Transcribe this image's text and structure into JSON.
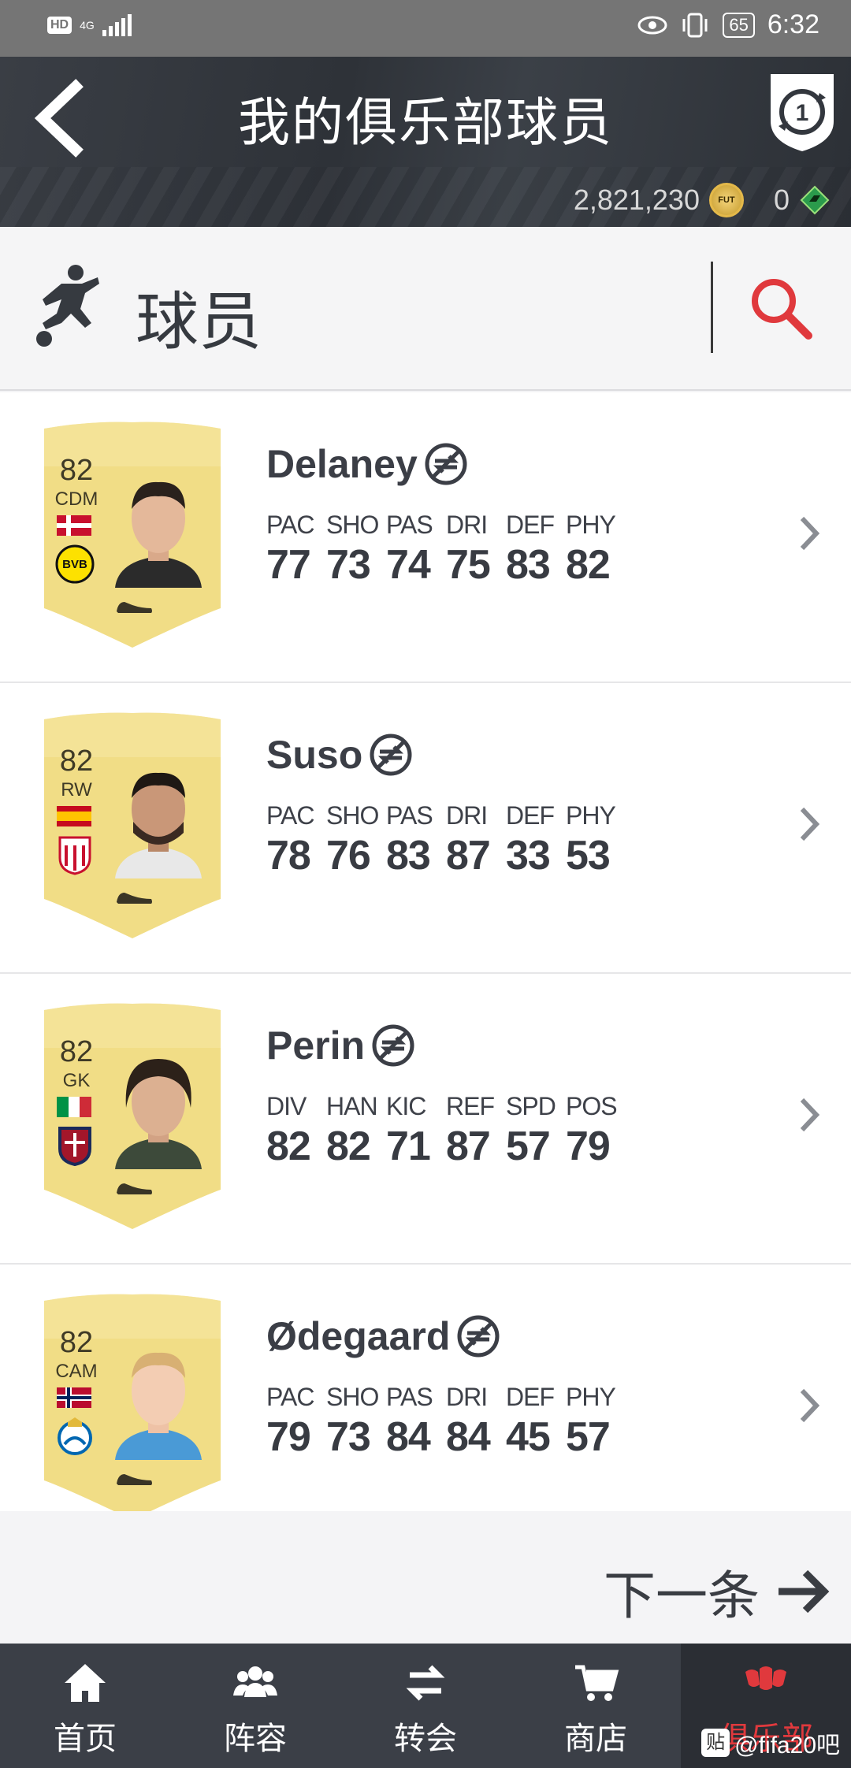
{
  "status_bar": {
    "hd": "HD",
    "network": "4G",
    "battery": "65",
    "time": "6:32"
  },
  "header": {
    "title": "我的俱乐部球员",
    "coins": "2,821,230",
    "coin_label": "FUT",
    "points": "0",
    "points_label": "EA"
  },
  "section": {
    "label": "球员"
  },
  "players": [
    {
      "name": "Delaney",
      "rating": "82",
      "position": "CDM",
      "stat_labels": [
        "PAC",
        "SHO",
        "PAS",
        "DRI",
        "DEF",
        "PHY"
      ],
      "stat_values": [
        "77",
        "73",
        "74",
        "75",
        "83",
        "82"
      ]
    },
    {
      "name": "Suso",
      "rating": "82",
      "position": "RW",
      "stat_labels": [
        "PAC",
        "SHO",
        "PAS",
        "DRI",
        "DEF",
        "PHY"
      ],
      "stat_values": [
        "78",
        "76",
        "83",
        "87",
        "33",
        "53"
      ]
    },
    {
      "name": "Perin",
      "rating": "82",
      "position": "GK",
      "stat_labels": [
        "DIV",
        "HAN",
        "KIC",
        "REF",
        "SPD",
        "POS"
      ],
      "stat_values": [
        "82",
        "82",
        "71",
        "87",
        "57",
        "79"
      ]
    },
    {
      "name": "Ødegaard",
      "rating": "82",
      "position": "CAM",
      "stat_labels": [
        "PAC",
        "SHO",
        "PAS",
        "DRI",
        "DEF",
        "PHY"
      ],
      "stat_values": [
        "79",
        "73",
        "84",
        "84",
        "45",
        "57"
      ]
    }
  ],
  "next_label": "下一条",
  "nav": [
    {
      "label": "首页",
      "icon": "home-icon"
    },
    {
      "label": "阵容",
      "icon": "squad-icon"
    },
    {
      "label": "转会",
      "icon": "transfers-icon"
    },
    {
      "label": "商店",
      "icon": "store-icon"
    },
    {
      "label": "俱乐部",
      "icon": "club-icon",
      "active": true
    }
  ],
  "watermark": {
    "badge": "贴",
    "text": "@fifa20吧"
  },
  "colors": {
    "accent": "#e0393d",
    "header_bg": "#33373e",
    "card_gold": "#f1dd86"
  }
}
